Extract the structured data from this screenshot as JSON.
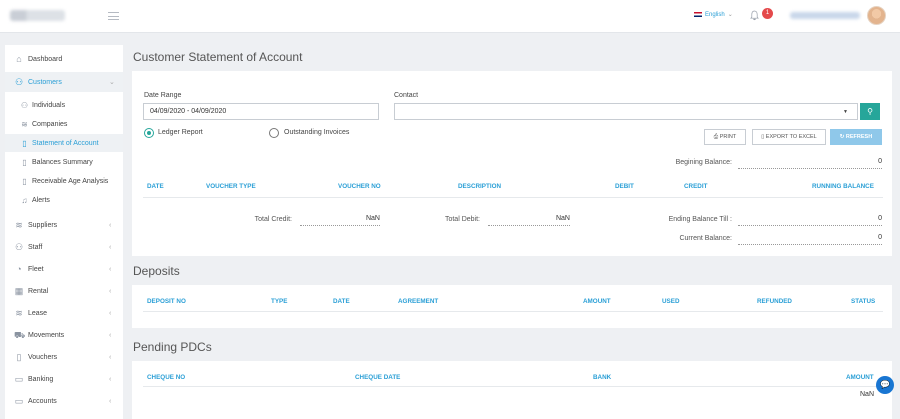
{
  "header": {
    "language": "English",
    "notification_count": "1"
  },
  "sidebar": {
    "items": [
      {
        "label": "Dashboard",
        "icon": "home-icon"
      },
      {
        "label": "Customers",
        "icon": "users-icon"
      },
      {
        "label": "Suppliers",
        "icon": "database-icon"
      },
      {
        "label": "Staff",
        "icon": "users-icon"
      },
      {
        "label": "Fleet",
        "icon": "gauge-icon"
      },
      {
        "label": "Rental",
        "icon": "table-icon"
      },
      {
        "label": "Lease",
        "icon": "database-icon"
      },
      {
        "label": "Movements",
        "icon": "car-icon"
      },
      {
        "label": "Vouchers",
        "icon": "phone-icon"
      },
      {
        "label": "Banking",
        "icon": "folder-icon"
      },
      {
        "label": "Accounts",
        "icon": "monitor-icon"
      }
    ],
    "customer_subitems": [
      {
        "label": "Individuals",
        "icon": "user-icon"
      },
      {
        "label": "Companies",
        "icon": "layers-icon"
      },
      {
        "label": "Statement of Account",
        "icon": "document-icon"
      },
      {
        "label": "Balances Summary",
        "icon": "document-icon"
      },
      {
        "label": "Receivable Age Analysis",
        "icon": "document-icon"
      },
      {
        "label": "Alerts",
        "icon": "bell-icon"
      }
    ]
  },
  "statement": {
    "title": "Customer Statement of Account",
    "date_range_label": "Date Range",
    "date_range_value": "04/09/2020 - 04/09/2020",
    "contact_label": "Contact",
    "contact_value": "",
    "report_options": [
      "Ledger Report",
      "Outstanding Invoices"
    ],
    "selected_report": "Ledger Report",
    "buttons": {
      "print": "PRINT",
      "export": "EXPORT TO EXCEL",
      "refresh": "REFRESH"
    },
    "beginning_balance_label": "Begining Balance:",
    "beginning_balance_value": "0",
    "columns": [
      "DATE",
      "VOUCHER TYPE",
      "VOUCHER NO",
      "DESCRIPTION",
      "DEBIT",
      "CREDIT",
      "RUNNING BALANCE"
    ],
    "total_credit_label": "Total Credit:",
    "total_credit_value": "NaN",
    "total_debit_label": "Total Debit:",
    "total_debit_value": "NaN",
    "ending_balance_label": "Ending Balance Till :",
    "ending_balance_value": "0",
    "current_balance_label": "Current Balance:",
    "current_balance_value": "0"
  },
  "deposits": {
    "title": "Deposits",
    "columns": [
      "DEPOSIT NO",
      "TYPE",
      "DATE",
      "AGREEMENT",
      "AMOUNT",
      "USED",
      "REFUNDED",
      "STATUS"
    ]
  },
  "pdcs": {
    "title": "Pending PDCs",
    "columns": [
      "CHEQUE NO",
      "CHEQUE DATE",
      "BANK",
      "AMOUNT"
    ],
    "amount_total": "NaN"
  },
  "colors": {
    "accent": "#2a9fd6",
    "teal": "#26a69a",
    "badge": "#e4494b"
  }
}
